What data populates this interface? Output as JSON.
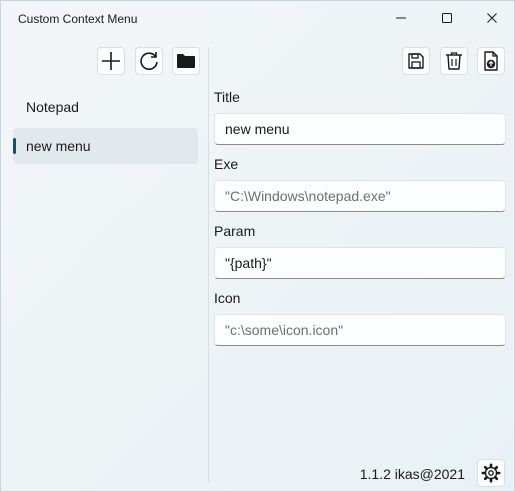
{
  "window": {
    "title": "Custom Context Menu",
    "controls": [
      "minimize",
      "maximize",
      "close"
    ]
  },
  "sidebar": {
    "toolbar": [
      {
        "name": "add-button",
        "icon": "plus-icon"
      },
      {
        "name": "refresh-button",
        "icon": "refresh-icon"
      },
      {
        "name": "open-folder-button",
        "icon": "folder-icon"
      }
    ],
    "items": [
      {
        "label": "Notepad",
        "selected": false
      },
      {
        "label": "new menu",
        "selected": true
      }
    ]
  },
  "editor": {
    "toolbar": [
      {
        "name": "save-button",
        "icon": "save-icon"
      },
      {
        "name": "delete-button",
        "icon": "trash-icon"
      },
      {
        "name": "export-button",
        "icon": "file-upload-icon"
      }
    ],
    "fields": {
      "title": {
        "label": "Title",
        "value": "new menu",
        "placeholder": ""
      },
      "exe": {
        "label": "Exe",
        "value": "",
        "placeholder": "\"C:\\Windows\\notepad.exe\""
      },
      "param": {
        "label": "Param",
        "value": "\"{path}\"",
        "placeholder": ""
      },
      "icon": {
        "label": "Icon",
        "value": "",
        "placeholder": "\"c:\\some\\icon.icon\""
      }
    }
  },
  "footer": {
    "version": "1.1.2 ikas@2021",
    "settings_icon": "gear-icon"
  },
  "colors": {
    "accent": "#005a70",
    "selected_bg": "#e1e9ed",
    "window_bg": "#eef4f6"
  }
}
